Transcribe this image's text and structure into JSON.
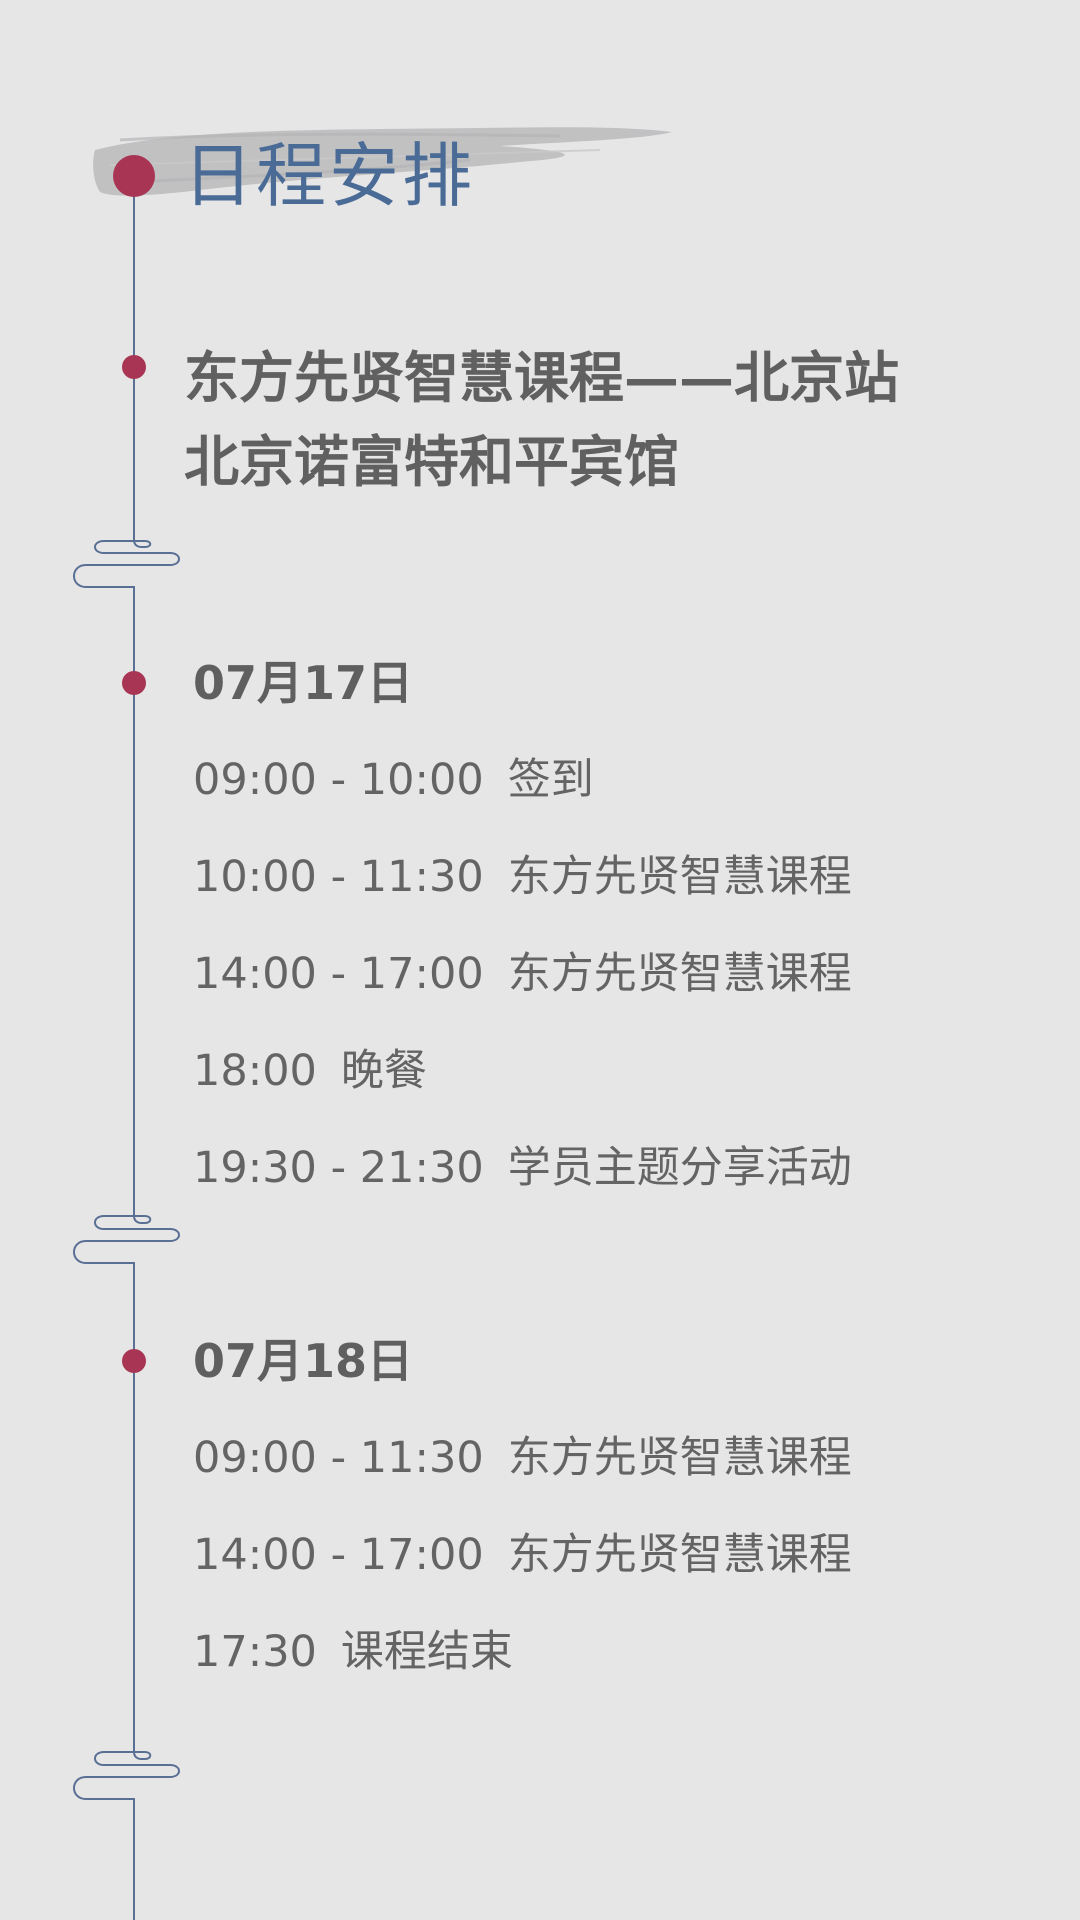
{
  "header": {
    "title": "日程安排"
  },
  "event": {
    "name": "东方先贤智慧课程——北京站",
    "venue": "北京诺富特和平宾馆"
  },
  "colors": {
    "background": "#e6e6e7",
    "accent_dot": "#a73553",
    "timeline_line": "#5a6f94",
    "title_blue": "#4a6b96",
    "text_gray": "#5e5e5e"
  },
  "days": [
    {
      "date": "07月17日",
      "items": [
        {
          "time": "09:00 - 10:00",
          "activity": "签到"
        },
        {
          "time": "10:00 - 11:30",
          "activity": "东方先贤智慧课程"
        },
        {
          "time": "14:00 - 17:00",
          "activity": "东方先贤智慧课程"
        },
        {
          "time": "18:00",
          "activity": "晚餐"
        },
        {
          "time": "19:30 - 21:30",
          "activity": "学员主题分享活动"
        }
      ]
    },
    {
      "date": "07月18日",
      "items": [
        {
          "time": "09:00 - 11:30",
          "activity": "东方先贤智慧课程"
        },
        {
          "time": "14:00 - 17:00",
          "activity": "东方先贤智慧课程"
        },
        {
          "time": "17:30",
          "activity": "课程结束"
        }
      ]
    }
  ]
}
